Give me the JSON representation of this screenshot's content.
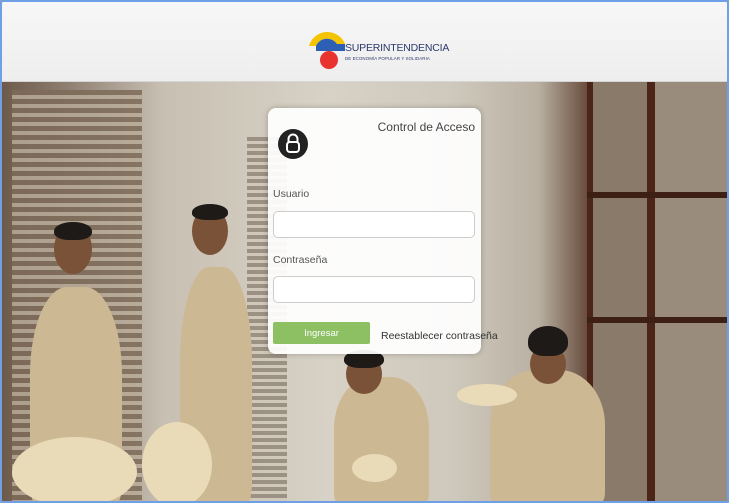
{
  "header": {
    "logo_name": "SUPERINTENDENCIA",
    "logo_subtitle": "DE ECONOMÍA POPULAR Y SOLIDARIA",
    "logo_colors": [
      "#f5c400",
      "#2d5fb4",
      "#e8332f"
    ]
  },
  "login": {
    "title": "Control de Acceso",
    "lock_icon": "lock-icon",
    "username_label": "Usuario",
    "username_value": "",
    "password_label": "Contraseña",
    "password_value": "",
    "submit_label": "Ingresar",
    "reset_label": "Reestablecer contraseña",
    "accent_color": "#8cc063"
  },
  "frame_color": "#6f9fe6"
}
